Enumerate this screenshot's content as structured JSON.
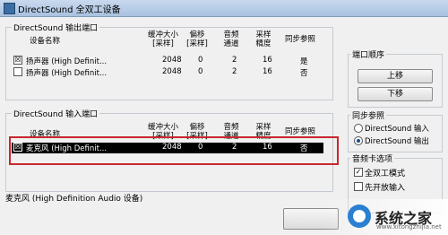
{
  "window": {
    "title": "DirectSound 全双工设备"
  },
  "output_group": {
    "label": "DirectSound 输出端口",
    "headers": {
      "name": "设备名称",
      "buffer": "缓冲大小\n[采样]",
      "offset": "偏移\n[采样]",
      "channels": "音频\n通道",
      "bits": "采样\n精度",
      "sync": "同步参照"
    },
    "rows": [
      {
        "checked": "☒",
        "name": "扬声器 (High Definit...",
        "buffer": "2048",
        "offset": "0",
        "channels": "2",
        "bits": "16",
        "sync": "是"
      },
      {
        "checked": "",
        "name": "扬声器 (High Definit...",
        "buffer": "2048",
        "offset": "0",
        "channels": "2",
        "bits": "16",
        "sync": "否"
      }
    ]
  },
  "input_group": {
    "label": "DirectSound 输入端口",
    "headers": {
      "name": "设备名称",
      "buffer": "缓冲大小\n[采样]",
      "offset": "偏移\n[采样]",
      "channels": "音频\n通道",
      "bits": "采样\n精度",
      "sync": "同步参照"
    },
    "rows": [
      {
        "checked": "☒",
        "name": "麦克风 (High Definit...",
        "buffer": "2048",
        "offset": "0",
        "channels": "2",
        "bits": "16",
        "sync": "否"
      }
    ]
  },
  "status_line": "麦克风 (High Definition Audio 设备)",
  "port_order": {
    "label": "端口顺序",
    "up": "上移",
    "down": "下移"
  },
  "sync_ref": {
    "label": "同步参照",
    "options": [
      "DirectSound 输入",
      "DirectSound 输出"
    ],
    "selected_index": 1
  },
  "audio_options": {
    "label": "音频卡选项",
    "full_duplex": "全双工模式",
    "full_duplex_checked": true,
    "open_input": "先开放输入",
    "open_input_checked": false
  },
  "watermark": {
    "text": "系统之家",
    "url": "www.xitongzhijia.net"
  }
}
